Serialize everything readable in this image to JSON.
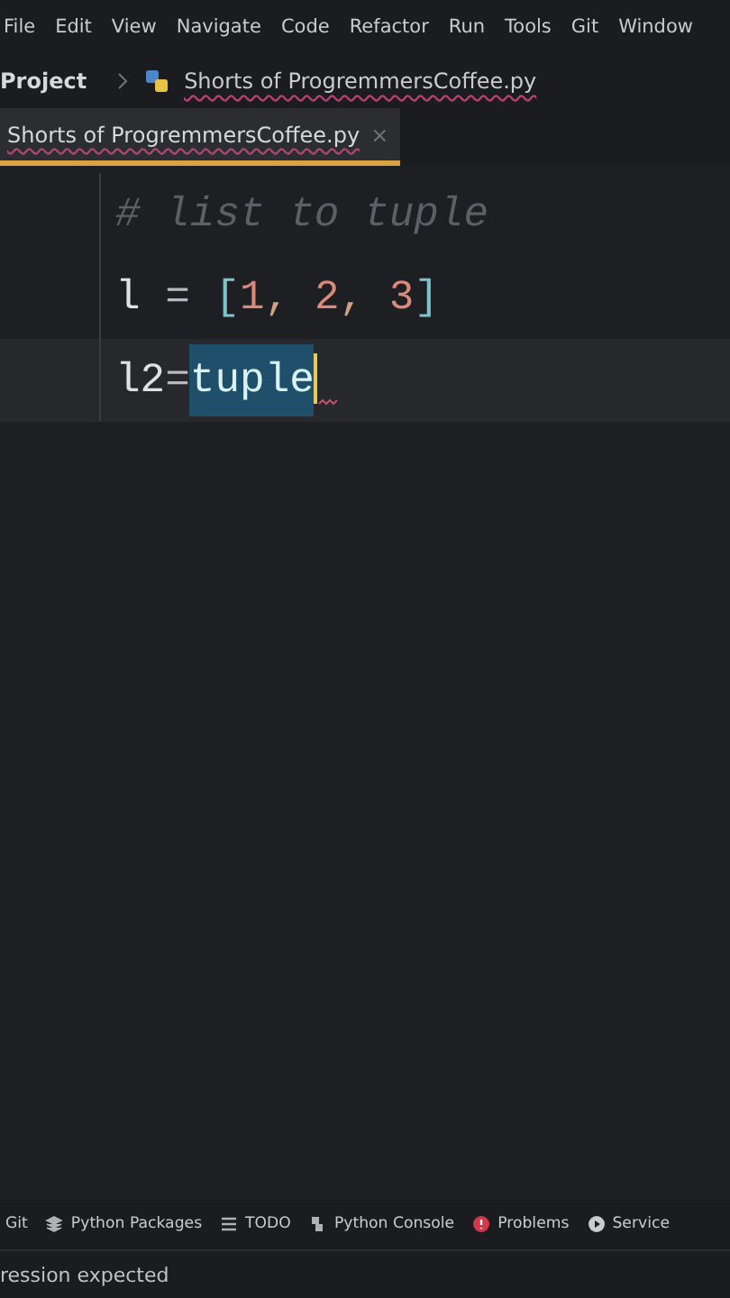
{
  "menu_bar": [
    "File",
    "Edit",
    "View",
    "Navigate",
    "Code",
    "Refactor",
    "Run",
    "Tools",
    "Git",
    "Window"
  ],
  "breadcrumb": {
    "project": "Project",
    "file": "Shorts of ProgremmersCoffee.py"
  },
  "tabs": [
    {
      "label": "Shorts of ProgremmersCoffee.py",
      "selected": true,
      "close": "×"
    }
  ],
  "editor": {
    "lines": [
      {
        "current": false,
        "tokens": [
          {
            "kind": "comment",
            "text": "# list to tuple"
          }
        ]
      },
      {
        "current": false,
        "tokens": [
          {
            "kind": "identifier",
            "text": "l"
          },
          {
            "kind": "operator",
            "text": " = "
          },
          {
            "kind": "bracket",
            "text": "["
          },
          {
            "kind": "number",
            "text": "1"
          },
          {
            "kind": "punct",
            "text": ", "
          },
          {
            "kind": "number",
            "text": "2"
          },
          {
            "kind": "punct",
            "text": ", "
          },
          {
            "kind": "number",
            "text": "3"
          },
          {
            "kind": "bracket",
            "text": "]"
          }
        ]
      },
      {
        "current": true,
        "tokens": [
          {
            "kind": "identifier",
            "text": "l2"
          },
          {
            "kind": "operator",
            "text": "="
          },
          {
            "kind": "selected",
            "text": "tuple"
          }
        ]
      }
    ]
  },
  "tool_windows": [
    {
      "kind": "git",
      "label": "Git"
    },
    {
      "kind": "packages",
      "label": "Python Packages"
    },
    {
      "kind": "todo",
      "label": "TODO"
    },
    {
      "kind": "console",
      "label": "Python Console"
    },
    {
      "kind": "problems",
      "label": "Problems"
    },
    {
      "kind": "services",
      "label": "Service"
    }
  ],
  "status_bar": {
    "message": "ression expected"
  }
}
